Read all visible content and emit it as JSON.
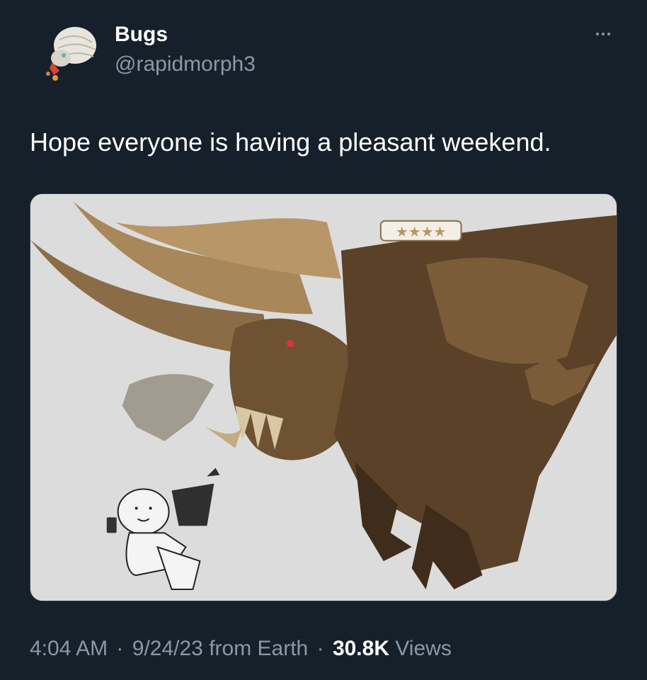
{
  "author": {
    "name": "Bugs",
    "handle": "@rapidmorph3"
  },
  "tweet": {
    "text": "Hope everyone is having a pleasant weekend.",
    "image_stars": "★★★★"
  },
  "meta": {
    "time": "4:04 AM",
    "separator": "·",
    "date": "9/24/23",
    "source": "from Earth",
    "views_count": "30.8K",
    "views_label": "Views"
  },
  "icons": {
    "more": "more-options-icon"
  },
  "colors": {
    "background": "#15202b",
    "secondary_text": "#8b98a5",
    "primary_text": "#ffffff",
    "media_background": "#dcdcdc"
  }
}
